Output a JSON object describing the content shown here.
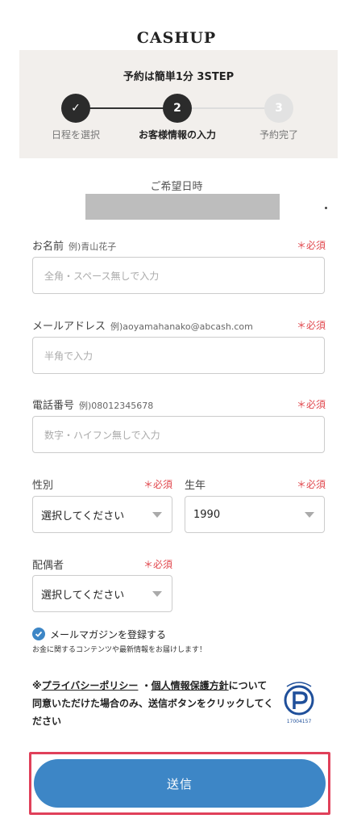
{
  "logo": "CASHUP",
  "steps": {
    "title": "予約は簡単1分 3STEP",
    "items": [
      {
        "number": "✓",
        "label": "日程を選択"
      },
      {
        "number": "2",
        "label": "お客様情報の入力"
      },
      {
        "number": "3",
        "label": "予約完了"
      }
    ]
  },
  "date": {
    "title": "ご希望日時"
  },
  "form": {
    "name": {
      "label": "お名前",
      "example": "例)青山花子",
      "required": "＊必須",
      "placeholder": "全角・スペース無しで入力"
    },
    "email": {
      "label": "メールアドレス",
      "example": "例)aoyamahanako@abcash.com",
      "required": "＊必須",
      "placeholder": "半角で入力"
    },
    "phone": {
      "label": "電話番号",
      "example": "例)08012345678",
      "required": "＊必須",
      "placeholder": "数字・ハイフン無しで入力"
    },
    "gender": {
      "label": "性別",
      "required": "＊必須",
      "value": "選択してください"
    },
    "birth_year": {
      "label": "生年",
      "required": "＊必須",
      "value": "1990"
    },
    "spouse": {
      "label": "配偶者",
      "required": "＊必須",
      "value": "選択してください"
    },
    "magazine": {
      "label": "メールマガジンを登録する",
      "sub": "お金に関するコンテンツや最新情報をお届けします！",
      "checked": true
    }
  },
  "policy": {
    "prefix": "※",
    "privacy_link": "プライバシーポリシー",
    "separator": "・",
    "personal_link": "個人情報保護方針",
    "text": "について同意いただけた場合のみ、送信ボタンをクリックしてください",
    "mark_number": "17004157"
  },
  "submit": {
    "label": "送信",
    "color": "#3d86c6"
  }
}
